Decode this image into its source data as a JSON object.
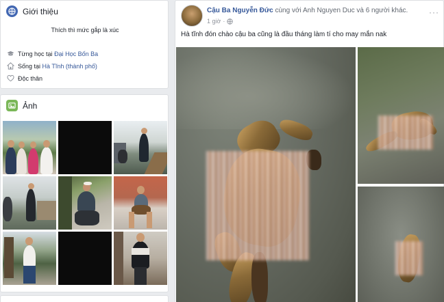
{
  "intro": {
    "title": "Giới thiệu",
    "bio": "Thích thì mức gắp là xúc",
    "items": [
      {
        "prefix": "Từng học tại ",
        "link": "Đại Học Bốn Ba",
        "suffix": "",
        "icon": "graduation-cap-icon"
      },
      {
        "prefix": "Sống tại ",
        "link": "Hà Tĩnh (thành phố)",
        "suffix": "",
        "icon": "home-icon"
      },
      {
        "prefix": "Độc thân",
        "link": "",
        "suffix": "",
        "icon": "heart-icon"
      }
    ]
  },
  "photos": {
    "title": "Ảnh",
    "icon": "photo-icon",
    "tiles": 9
  },
  "post": {
    "author": "Cậu Ba Nguyễn Đức",
    "with_prefix": "cùng với",
    "with_name": "Anh Nguyen Duc",
    "with_others": "và 6 người khác.",
    "time": "1 giờ",
    "privacy_icon": "globe-icon",
    "text": "Hà tĩnh đón chào cậu ba cũng là đầu tháng làm tí cho may mắn nak",
    "more": "···"
  },
  "colors": {
    "fb_blue": "#365899",
    "intro_icon": "#4267b2",
    "photo_icon": "#7ab758",
    "background": "#e9ebee"
  }
}
